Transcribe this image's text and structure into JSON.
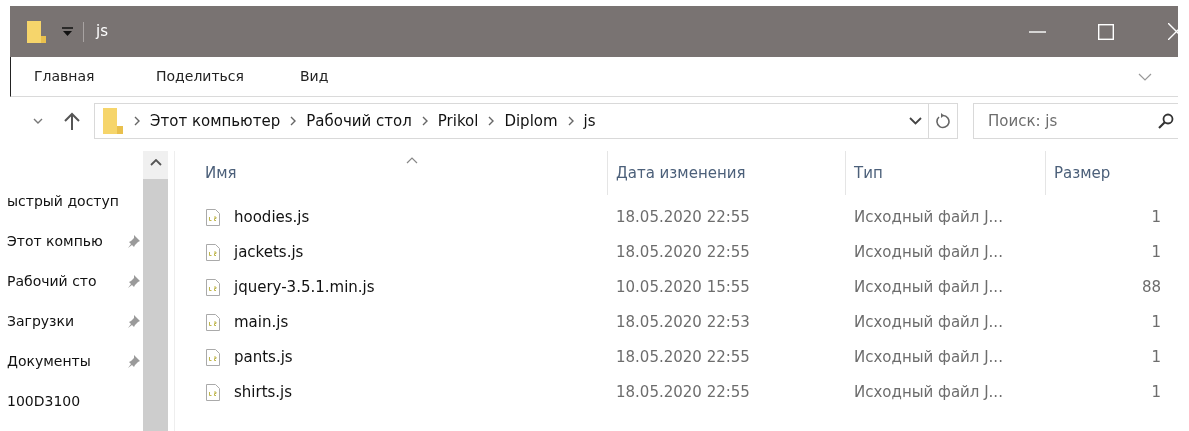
{
  "window": {
    "title": "js"
  },
  "ribbon_tabs": [
    "Главная",
    "Поделиться",
    "Вид"
  ],
  "address": {
    "crumbs": [
      "Этот компьютер",
      "Рабочий стол",
      "Prikol",
      "Diplom",
      "js"
    ]
  },
  "search": {
    "placeholder": "Поиск: js"
  },
  "sidebar": {
    "items": [
      {
        "label": "ыстрый доступ",
        "pinned": false
      },
      {
        "label": "Этот компью",
        "pinned": true
      },
      {
        "label": "Рабочий сто",
        "pinned": true
      },
      {
        "label": "Загрузки",
        "pinned": true
      },
      {
        "label": "Документы",
        "pinned": true
      },
      {
        "label": "100D3100",
        "pinned": false
      }
    ]
  },
  "table": {
    "columns": [
      "Имя",
      "Дата изменения",
      "Тип",
      "Размер"
    ],
    "rows": [
      {
        "name": "hoodies.js",
        "date": "18.05.2020 22:55",
        "type": "Исходный файл J...",
        "size": "1"
      },
      {
        "name": "jackets.js",
        "date": "18.05.2020 22:55",
        "type": "Исходный файл J...",
        "size": "1"
      },
      {
        "name": "jquery-3.5.1.min.js",
        "date": "10.05.2020 15:55",
        "type": "Исходный файл J...",
        "size": "88"
      },
      {
        "name": "main.js",
        "date": "18.05.2020 22:53",
        "type": "Исходный файл J...",
        "size": "1"
      },
      {
        "name": "pants.js",
        "date": "18.05.2020 22:55",
        "type": "Исходный файл J...",
        "size": "1"
      },
      {
        "name": "shirts.js",
        "date": "18.05.2020 22:55",
        "type": "Исходный файл J...",
        "size": "1"
      }
    ]
  }
}
